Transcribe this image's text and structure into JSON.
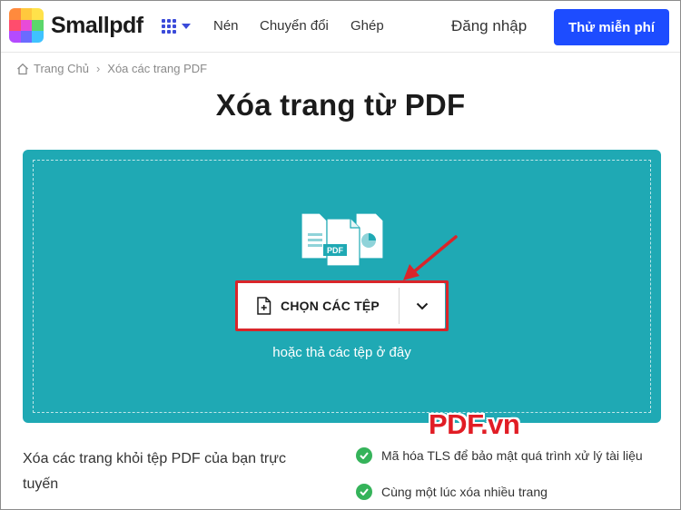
{
  "header": {
    "brand": "Smallpdf",
    "nav": [
      "Nén",
      "Chuyển đổi",
      "Ghép"
    ],
    "login_label": "Đăng nhập",
    "cta_label": "Thử miễn phí",
    "colors": {
      "accent": "#1d4cff",
      "grid_icon": "#3a4ad9"
    }
  },
  "breadcrumb": {
    "home_label": "Trang Chủ",
    "current_label": "Xóa các trang PDF"
  },
  "main": {
    "title": "Xóa trang từ PDF",
    "dropzone": {
      "choose_label": "CHỌN CÁC TỆP",
      "drop_hint": "hoặc thả các tệp ở đây",
      "illustration_badge": "PDF",
      "background_color": "#1fa9b4"
    },
    "description": "Xóa các trang khỏi tệp PDF của bạn trực tuyến",
    "features": [
      "Mã hóa TLS để bảo mật quá trình xử lý tài liệu",
      "Cùng một lúc xóa nhiều trang"
    ]
  },
  "annotation": {
    "watermark": "PDF.vn",
    "highlight_color": "#d9252a"
  }
}
